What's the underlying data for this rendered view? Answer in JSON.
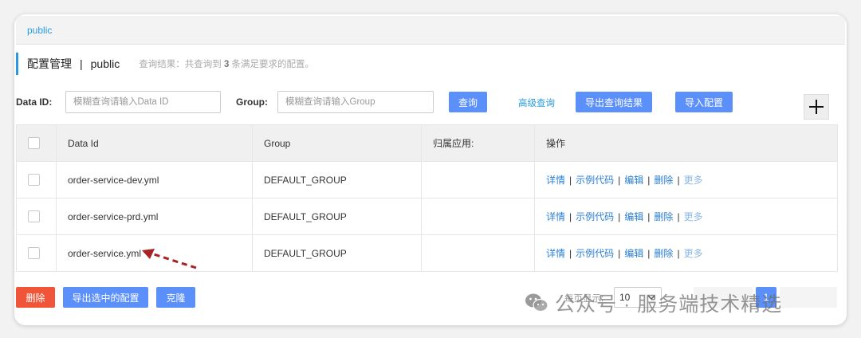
{
  "namespace_bar": {
    "label": "public"
  },
  "title": {
    "main": "配置管理",
    "separator": "|",
    "namespace": "public",
    "result_prefix": "查询结果：共查询到",
    "result_count": "3",
    "result_suffix": "条满足要求的配置。"
  },
  "search": {
    "data_id_label": "Data ID:",
    "data_id_placeholder": "模糊查询请输入Data ID",
    "group_label": "Group:",
    "group_placeholder": "模糊查询请输入Group",
    "query_button": "查询",
    "advanced_link": "高级查询",
    "export_results_button": "导出查询结果",
    "import_button": "导入配置"
  },
  "table": {
    "headers": [
      "Data Id",
      "Group",
      "归属应用:",
      "操作"
    ],
    "rows": [
      {
        "data_id": "order-service-dev.yml",
        "group": "DEFAULT_GROUP",
        "app": ""
      },
      {
        "data_id": "order-service-prd.yml",
        "group": "DEFAULT_GROUP",
        "app": ""
      },
      {
        "data_id": "order-service.yml",
        "group": "DEFAULT_GROUP",
        "app": ""
      }
    ],
    "actions": {
      "detail": "详情",
      "sample_code": "示例代码",
      "edit": "编辑",
      "delete": "删除",
      "more": "更多",
      "sep": "|"
    }
  },
  "footer": {
    "delete_button": "删除",
    "export_selected_button": "导出选中的配置",
    "clone_button": "克隆",
    "page_size_label": "每页显示:",
    "page_size_value": "10",
    "current_page": "1"
  },
  "watermark": {
    "text": "公众号 · 服务端技术精选"
  },
  "colors": {
    "primary": "#5b8ff9",
    "link": "#2a7fd4",
    "danger": "#f0553a",
    "annotation_arrow": "#a52424"
  },
  "icons": {
    "add": "plus-icon",
    "chevron": "chevron-down-icon",
    "watermark": "wechat-icon",
    "annotation": "dashed-arrow-icon"
  }
}
